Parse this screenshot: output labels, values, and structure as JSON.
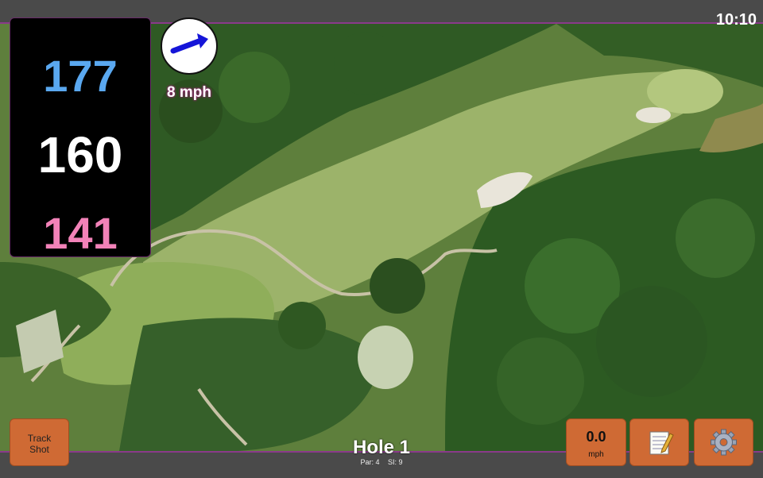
{
  "status_bar": {
    "time": "10:10"
  },
  "distances": {
    "back": "177",
    "middle": "160",
    "front": "141"
  },
  "wind": {
    "speed_label": "8 mph",
    "icon": "wind-arrow-icon"
  },
  "hole": {
    "title": "Hole 1",
    "par": "Par: 4",
    "stroke_index": "SI: 9"
  },
  "buttons": {
    "track_shot": {
      "line1": "Track",
      "line2": "Shot"
    },
    "speed": {
      "value": "0.0",
      "unit": "mph"
    },
    "notes": {
      "icon": "notepad-icon"
    },
    "settings": {
      "icon": "gear-icon"
    }
  },
  "colors": {
    "back": "#5aa8f0",
    "middle": "#ffffff",
    "front": "#f282b8",
    "button": "#cf6a34",
    "accent_border": "#8a3a8a"
  }
}
